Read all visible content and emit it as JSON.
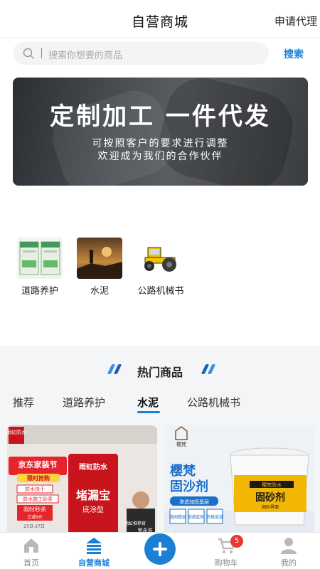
{
  "header": {
    "title": "自营商城",
    "apply_label": "申请代理"
  },
  "search": {
    "placeholder": "搜索你想要的商品",
    "button_label": "搜索"
  },
  "banner": {
    "headline": "定制加工 一件代发",
    "line1": "可按照客户的要求进行调整",
    "line2": "欢迎成为我们的合作伙伴"
  },
  "categories": [
    {
      "label": "道路养护",
      "icon": "road-maintenance-product-image"
    },
    {
      "label": "水泥",
      "icon": "cement-image"
    },
    {
      "label": "公路机械书",
      "icon": "road-roller-image"
    }
  ],
  "hot": {
    "title": "热门商品",
    "tabs": [
      {
        "label": "推荐"
      },
      {
        "label": "道路养护"
      },
      {
        "label": "水泥",
        "active": true
      },
      {
        "label": "公路机械书"
      }
    ],
    "products": [
      {
        "brand": "雨虹防水",
        "promo": "京东家装节",
        "promo_sub": "限时抢购",
        "tags": [
          "防水快干",
          "防水施工砂浆"
        ],
        "deal": "限时秒杀",
        "deal_sub": "立减9元",
        "date": "25日-27日",
        "product_name": "堵漏宝",
        "product_sub": "底涂型",
        "recommender": "雨虹推荐官",
        "person_name": "罗永浩"
      },
      {
        "brand": "樱梵",
        "product_name": "樱梵",
        "product_name2": "固沙剂",
        "subtitle": "渗透加固基层",
        "features": [
          "稳固基层",
          "拒绝起砂",
          "防械返潮"
        ],
        "bucket_brand": "樱梵防水",
        "bucket_label": "固砂剂",
        "bucket_sub": "固砂界面"
      }
    ]
  },
  "tabbar": {
    "items": [
      {
        "label": "首页"
      },
      {
        "label": "自营商城",
        "active": true
      },
      {
        "label": "购物车"
      },
      {
        "label": "我的"
      }
    ],
    "cart_badge": "5"
  },
  "colors": {
    "accent": "#1b7fd6",
    "badge": "#e8382f",
    "hot_bg": "#f4f5f7"
  }
}
